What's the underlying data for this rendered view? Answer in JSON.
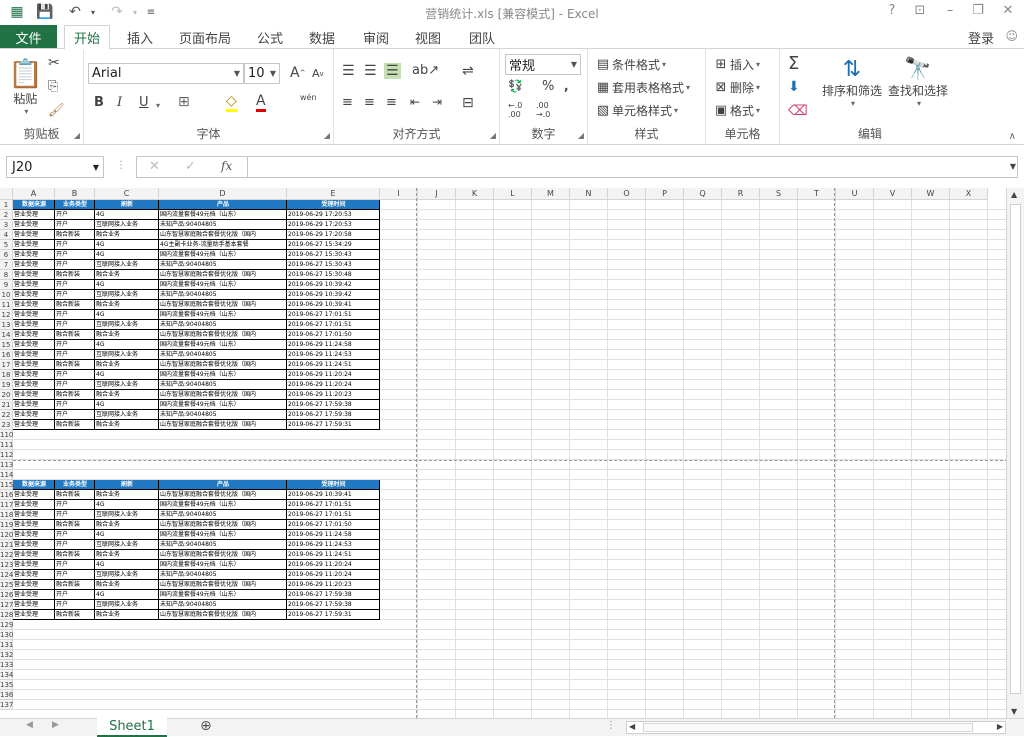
{
  "title": {
    "file": "营销统计.xls",
    "mode": "[兼容模式]",
    "app": "Excel"
  },
  "tabs": {
    "file": "文件",
    "items": [
      "开始",
      "插入",
      "页面布局",
      "公式",
      "数据",
      "审阅",
      "视图",
      "团队"
    ],
    "active": "开始"
  },
  "login": "登录",
  "ribbon": {
    "clipboard": {
      "label": "剪贴板",
      "paste": "粘贴"
    },
    "font": {
      "label": "字体",
      "name": "Arial",
      "size": "10",
      "bold": "B",
      "italic": "I",
      "underline": "U",
      "wen": "wén"
    },
    "alignment": {
      "label": "对齐方式"
    },
    "number": {
      "label": "数字",
      "format": "常规"
    },
    "styles": {
      "label": "样式",
      "conditional": "条件格式",
      "table": "套用表格格式",
      "cell": "单元格样式"
    },
    "cells": {
      "label": "单元格",
      "insert": "插入",
      "delete": "删除",
      "format": "格式"
    },
    "editing": {
      "label": "编辑",
      "sort": "排序和筛选",
      "find": "查找和选择"
    }
  },
  "formula_bar": {
    "name_box": "J20",
    "fx": "fx",
    "content": ""
  },
  "columns": [
    "A",
    "B",
    "C",
    "D",
    "E",
    "I",
    "J",
    "K",
    "L",
    "M",
    "N",
    "O",
    "P",
    "Q",
    "R",
    "S",
    "T",
    "U",
    "V",
    "W",
    "X"
  ],
  "headers": [
    "数据来源",
    "业务类型",
    "刷新",
    "产品",
    "受理时间"
  ],
  "rows1": [
    [
      "2",
      "营业受理",
      "开户",
      "4G",
      "国内流量套餐49元档（山东）",
      "2019-06-29 17:20:53"
    ],
    [
      "3",
      "营业受理",
      "开户",
      "互联网接入业务",
      "未知产品:90404805",
      "2019-06-29 17:20:53"
    ],
    [
      "4",
      "营业受理",
      "融合新装",
      "融合业务",
      "山东智慧家庭融合套餐优化版（国内",
      "2019-06-29 17:20:58"
    ],
    [
      "5",
      "营业受理",
      "开户",
      "4G",
      "4G主副卡业务-流量助手基本套餐",
      "2019-06-27 15:34:29"
    ],
    [
      "6",
      "营业受理",
      "开户",
      "4G",
      "国内流量套餐49元档（山东）",
      "2019-06-27 15:30:43"
    ],
    [
      "7",
      "营业受理",
      "开户",
      "互联网接入业务",
      "未知产品:90404805",
      "2019-06-27 15:30:43"
    ],
    [
      "8",
      "营业受理",
      "融合新装",
      "融合业务",
      "山东智慧家庭融合套餐优化版（国内",
      "2019-06-27 15:30:48"
    ],
    [
      "9",
      "营业受理",
      "开户",
      "4G",
      "国内流量套餐49元档（山东）",
      "2019-06-29 10:39:42"
    ],
    [
      "10",
      "营业受理",
      "开户",
      "互联网接入业务",
      "未知产品:90404805",
      "2019-06-29 10:39:42"
    ],
    [
      "11",
      "营业受理",
      "融合新装",
      "融合业务",
      "山东智慧家庭融合套餐优化版（国内",
      "2019-06-29 10:39:41"
    ],
    [
      "12",
      "营业受理",
      "开户",
      "4G",
      "国内流量套餐49元档（山东）",
      "2019-06-27 17:01:51"
    ],
    [
      "13",
      "营业受理",
      "开户",
      "互联网接入业务",
      "未知产品:90404805",
      "2019-06-27 17:01:51"
    ],
    [
      "14",
      "营业受理",
      "融合新装",
      "融合业务",
      "山东智慧家庭融合套餐优化版（国内",
      "2019-06-27 17:01:50"
    ],
    [
      "15",
      "营业受理",
      "开户",
      "4G",
      "国内流量套餐49元档（山东）",
      "2019-06-29 11:24:58"
    ],
    [
      "16",
      "营业受理",
      "开户",
      "互联网接入业务",
      "未知产品:90404805",
      "2019-06-29 11:24:53"
    ],
    [
      "17",
      "营业受理",
      "融合新装",
      "融合业务",
      "山东智慧家庭融合套餐优化版（国内",
      "2019-06-29 11:24:51"
    ],
    [
      "18",
      "营业受理",
      "开户",
      "4G",
      "国内流量套餐49元档（山东）",
      "2019-06-29 11:20:24"
    ],
    [
      "19",
      "营业受理",
      "开户",
      "互联网接入业务",
      "未知产品:90404805",
      "2019-06-29 11:20:24"
    ],
    [
      "20",
      "营业受理",
      "融合新装",
      "融合业务",
      "山东智慧家庭融合套餐优化版（国内",
      "2019-06-29 11:20:23"
    ],
    [
      "21",
      "营业受理",
      "开户",
      "4G",
      "国内流量套餐49元档（山东）",
      "2019-06-27 17:59:38"
    ],
    [
      "22",
      "营业受理",
      "开户",
      "互联网接入业务",
      "未知产品:90404805",
      "2019-06-27 17:59:38"
    ],
    [
      "23",
      "营业受理",
      "融合新装",
      "融合业务",
      "山东智慧家庭融合套餐优化版（国内",
      "2019-06-27 17:59:31"
    ]
  ],
  "rows2": [
    [
      "116",
      "营业受理",
      "融合新装",
      "融合业务",
      "山东智慧家庭融合套餐优化版（国内",
      "2019-06-29 10:39:41"
    ],
    [
      "117",
      "营业受理",
      "开户",
      "4G",
      "国内流量套餐49元档（山东）",
      "2019-06-27 17:01:51"
    ],
    [
      "118",
      "营业受理",
      "开户",
      "互联网接入业务",
      "未知产品:90404805",
      "2019-06-27 17:01:51"
    ],
    [
      "119",
      "营业受理",
      "融合新装",
      "融合业务",
      "山东智慧家庭融合套餐优化版（国内",
      "2019-06-27 17:01:50"
    ],
    [
      "120",
      "营业受理",
      "开户",
      "4G",
      "国内流量套餐49元档（山东）",
      "2019-06-29 11:24:58"
    ],
    [
      "121",
      "营业受理",
      "开户",
      "互联网接入业务",
      "未知产品:90404805",
      "2019-06-29 11:24:53"
    ],
    [
      "122",
      "营业受理",
      "融合新装",
      "融合业务",
      "山东智慧家庭融合套餐优化版（国内",
      "2019-06-29 11:24:51"
    ],
    [
      "123",
      "营业受理",
      "开户",
      "4G",
      "国内流量套餐49元档（山东）",
      "2019-06-29 11:20:24"
    ],
    [
      "124",
      "营业受理",
      "开户",
      "互联网接入业务",
      "未知产品:90404805",
      "2019-06-29 11:20:24"
    ],
    [
      "125",
      "营业受理",
      "融合新装",
      "融合业务",
      "山东智慧家庭融合套餐优化版（国内",
      "2019-06-29 11:20:23"
    ],
    [
      "126",
      "营业受理",
      "开户",
      "4G",
      "国内流量套餐49元档（山东）",
      "2019-06-27 17:59:38"
    ],
    [
      "127",
      "营业受理",
      "开户",
      "互联网接入业务",
      "未知产品:90404805",
      "2019-06-27 17:59:38"
    ],
    [
      "128",
      "营业受理",
      "融合新装",
      "融合业务",
      "山东智慧家庭融合套餐优化版（国内",
      "2019-06-27 17:59:31"
    ]
  ],
  "header_rows": {
    "first": "1",
    "second": "115"
  },
  "empty_rows_a": [
    "110",
    "111",
    "112",
    "113",
    "114"
  ],
  "empty_rows_b": [
    "129",
    "130",
    "131",
    "132",
    "133",
    "134",
    "135",
    "136",
    "137"
  ],
  "sheet_tab": "Sheet1",
  "accent": "#217346",
  "table_header_color": "#1f78c1"
}
